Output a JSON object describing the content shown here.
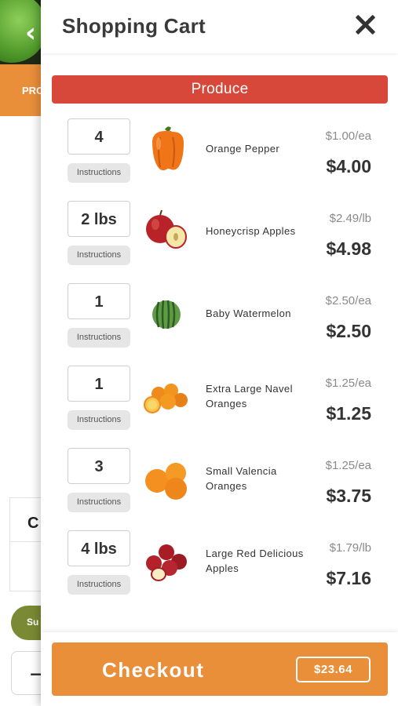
{
  "background": {
    "back_glyph": "‹",
    "tab_text": "PRO",
    "card_letter": "C",
    "pill_text": "Su",
    "stepper_minus": "−"
  },
  "cart": {
    "title": "Shopping Cart",
    "close_icon": "close-icon",
    "category": "Produce",
    "instructions_label": "Instructions",
    "items": [
      {
        "qty": "4",
        "name": "Orange Pepper",
        "unit_price": "$1.00/ea",
        "total": "$4.00",
        "icon": "orange-pepper-icon"
      },
      {
        "qty": "2 lbs",
        "name": "Honeycrisp Apples",
        "unit_price": "$2.49/lb",
        "total": "$4.98",
        "icon": "apple-icon"
      },
      {
        "qty": "1",
        "name": "Baby Watermelon",
        "unit_price": "$2.50/ea",
        "total": "$2.50",
        "icon": "watermelon-icon"
      },
      {
        "qty": "1",
        "name": "Extra Large Navel Oranges",
        "unit_price": "$1.25/ea",
        "total": "$1.25",
        "icon": "oranges-icon"
      },
      {
        "qty": "3",
        "name": "Small Valencia Oranges",
        "unit_price": "$1.25/ea",
        "total": "$3.75",
        "icon": "oranges-icon"
      },
      {
        "qty": "4 lbs",
        "name": "Large Red Delicious Apples",
        "unit_price": "$1.79/lb",
        "total": "$7.16",
        "icon": "red-apples-icon"
      }
    ],
    "checkout_label": "Checkout",
    "checkout_total": "$23.64"
  },
  "colors": {
    "accent_orange": "#e98f3a",
    "category_red": "#d8483a",
    "pill_green": "#7a8a34"
  }
}
